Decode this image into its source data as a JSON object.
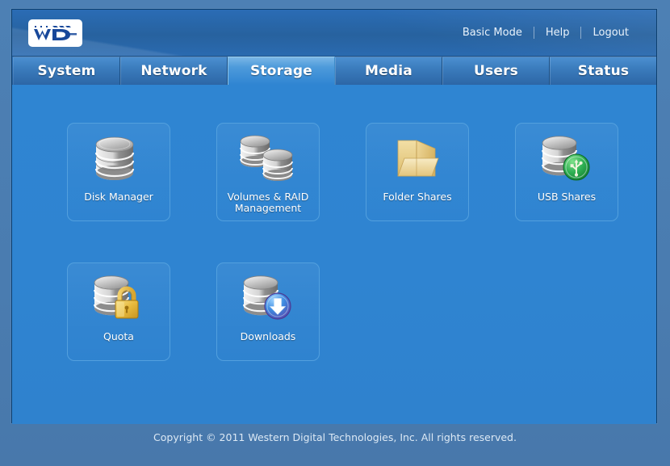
{
  "header": {
    "logo_text": "WD",
    "links": [
      {
        "label": "Basic Mode",
        "name": "basic-mode-link"
      },
      {
        "label": "Help",
        "name": "help-link"
      },
      {
        "label": "Logout",
        "name": "logout-link"
      }
    ]
  },
  "nav": {
    "tabs": [
      {
        "label": "System",
        "active": false
      },
      {
        "label": "Network",
        "active": false
      },
      {
        "label": "Storage",
        "active": true
      },
      {
        "label": "Media",
        "active": false
      },
      {
        "label": "Users",
        "active": false
      },
      {
        "label": "Status",
        "active": false
      }
    ]
  },
  "main": {
    "tiles": [
      {
        "label": "Disk Manager",
        "icon": "disk-stack-icon"
      },
      {
        "label": "Volumes & RAID Management",
        "icon": "double-disk-stack-icon"
      },
      {
        "label": "Folder Shares",
        "icon": "folder-icon"
      },
      {
        "label": "USB Shares",
        "icon": "disk-stack-usb-badge-icon"
      },
      {
        "label": "Quota",
        "icon": "disk-stack-lock-icon"
      },
      {
        "label": "Downloads",
        "icon": "disk-stack-download-badge-icon"
      }
    ]
  },
  "footer": {
    "copyright": "Copyright © 2011 Western Digital Technologies, Inc. All rights reserved."
  },
  "colors": {
    "page_background": "#4a7cb0",
    "panel_background": "#2f84d1",
    "header_blue": "#27629f",
    "tab_blue": "#3b7cbd",
    "active_tab_blue": "#4e9bdb",
    "tile_border": "#53a0de",
    "text_white": "#ffffff",
    "logo_blue": "#18489a",
    "folder_yellow": "#e8c87a",
    "usb_badge_green": "#2aa94a",
    "download_badge_blue": "#3a7fd5",
    "lock_gold": "#e8c24a",
    "disk_gray": "#bcbcbc"
  }
}
